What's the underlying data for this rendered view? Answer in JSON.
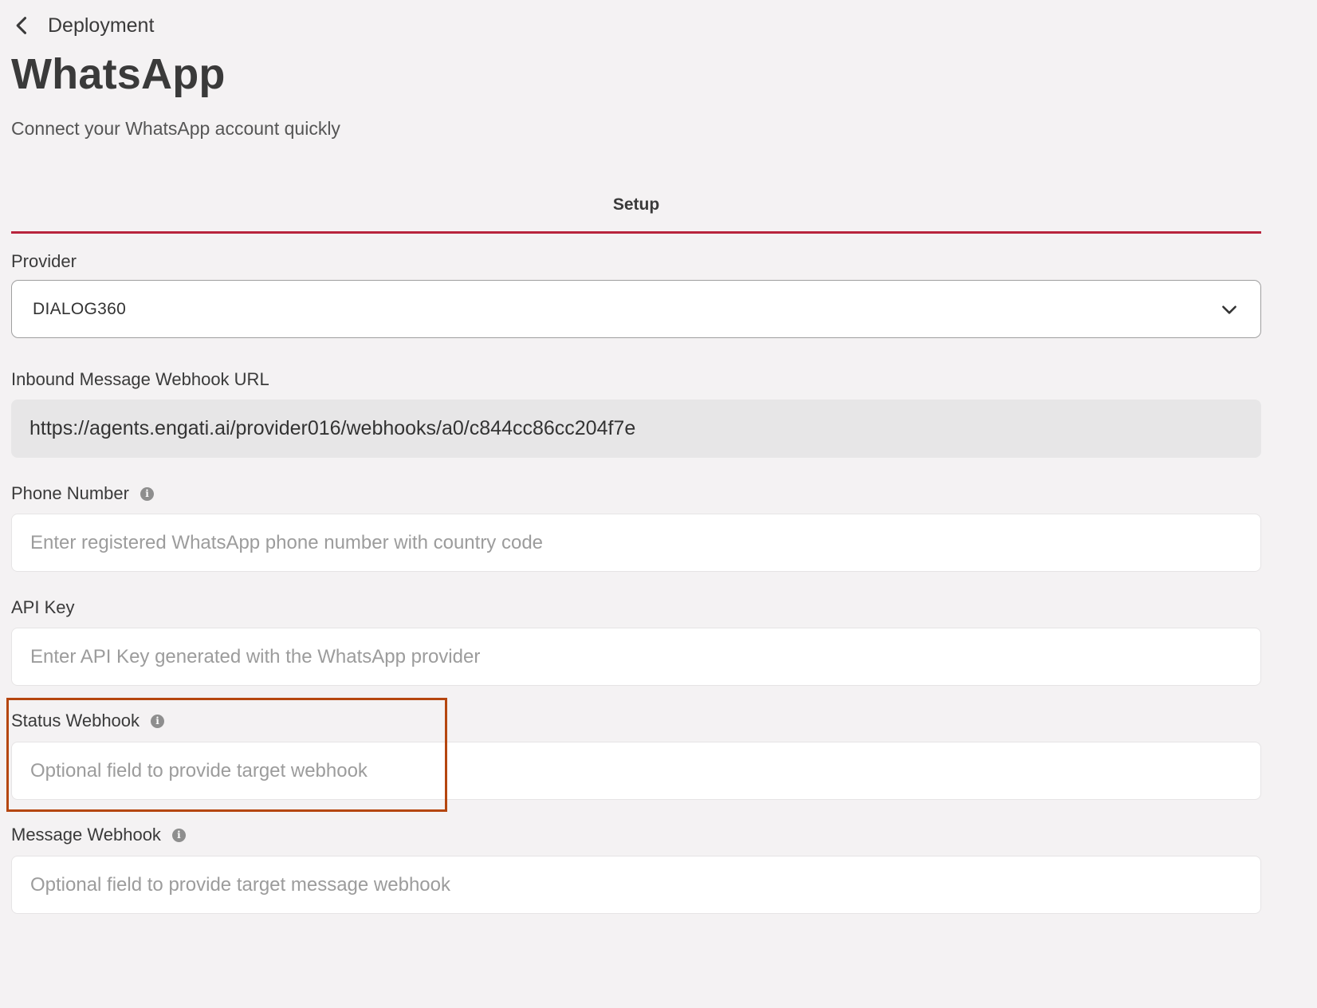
{
  "header": {
    "back_label": "Deployment",
    "title": "WhatsApp",
    "subtitle": "Connect your WhatsApp account quickly"
  },
  "tabs": [
    {
      "label": "Setup",
      "active": true
    }
  ],
  "accent_color": "#b8243c",
  "highlight_color": "#b5460f",
  "form": {
    "provider": {
      "label": "Provider",
      "value": "DIALOG360"
    },
    "inbound_webhook": {
      "label": "Inbound Message Webhook URL",
      "value": "https://agents.engati.ai/provider016/webhooks/a0/c844cc86cc204f7e"
    },
    "phone_number": {
      "label": "Phone Number",
      "placeholder": "Enter registered WhatsApp phone number with country code",
      "value": ""
    },
    "api_key": {
      "label": "API Key",
      "placeholder": "Enter API Key generated with the WhatsApp provider",
      "value": ""
    },
    "status_webhook": {
      "label": "Status Webhook",
      "placeholder": "Optional field to provide target webhook",
      "value": ""
    },
    "message_webhook": {
      "label": "Message Webhook",
      "placeholder": "Optional field to provide target message webhook",
      "value": ""
    }
  },
  "icons": {
    "back": "chevron-left-icon",
    "dropdown": "chevron-down-icon",
    "info": "info-icon"
  }
}
